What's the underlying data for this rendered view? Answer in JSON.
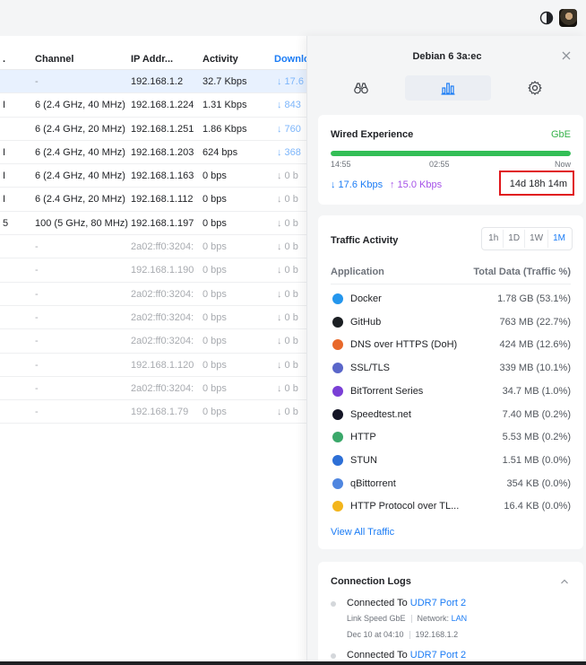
{
  "table": {
    "headers": {
      "edge": ".",
      "channel": "Channel",
      "ip": "IP Addr...",
      "activity": "Activity",
      "download": "Downlc"
    },
    "rows": [
      {
        "edge": "",
        "channel": "-",
        "ip": "192.168.1.2",
        "activity": "32.7 Kbps",
        "dl": "↓  17.6",
        "style": "sel"
      },
      {
        "edge": "I",
        "channel": "6 (2.4 GHz, 40 MHz)",
        "ip": "192.168.1.224",
        "activity": "1.31 Kbps",
        "dl": "↓  843",
        "style": ""
      },
      {
        "edge": "",
        "channel": "6 (2.4 GHz, 20 MHz)",
        "ip": "192.168.1.251",
        "activity": "1.86 Kbps",
        "dl": "↓  760",
        "style": ""
      },
      {
        "edge": "I",
        "channel": "6 (2.4 GHz, 40 MHz)",
        "ip": "192.168.1.203",
        "activity": "624 bps",
        "dl": "↓  368",
        "style": ""
      },
      {
        "edge": "I",
        "channel": "6 (2.4 GHz, 40 MHz)",
        "ip": "192.168.1.163",
        "activity": "0 bps",
        "dl": "↓  0 b",
        "style": "plain"
      },
      {
        "edge": "I",
        "channel": "6 (2.4 GHz, 20 MHz)",
        "ip": "192.168.1.112",
        "activity": "0 bps",
        "dl": "↓  0 b",
        "style": "plain"
      },
      {
        "edge": "5",
        "channel": "100 (5 GHz, 80 MHz)",
        "ip": "192.168.1.197",
        "activity": "0 bps",
        "dl": "↓  0 b",
        "style": "plain"
      },
      {
        "edge": "",
        "channel": "-",
        "ip": "2a02:ff0:3204:",
        "activity": "0 bps",
        "dl": "↓  0 b",
        "style": "dim"
      },
      {
        "edge": "",
        "channel": "-",
        "ip": "192.168.1.190",
        "activity": "0 bps",
        "dl": "↓  0 b",
        "style": "dim"
      },
      {
        "edge": "",
        "channel": "-",
        "ip": "2a02:ff0:3204:",
        "activity": "0 bps",
        "dl": "↓  0 b",
        "style": "dim"
      },
      {
        "edge": "",
        "channel": "-",
        "ip": "2a02:ff0:3204:",
        "activity": "0 bps",
        "dl": "↓  0 b",
        "style": "dim"
      },
      {
        "edge": "",
        "channel": "-",
        "ip": "2a02:ff0:3204:",
        "activity": "0 bps",
        "dl": "↓  0 b",
        "style": "dim"
      },
      {
        "edge": "",
        "channel": "-",
        "ip": "192.168.1.120",
        "activity": "0 bps",
        "dl": "↓  0 b",
        "style": "dim"
      },
      {
        "edge": "",
        "channel": "-",
        "ip": "2a02:ff0:3204:",
        "activity": "0 bps",
        "dl": "↓  0 b",
        "style": "dim"
      },
      {
        "edge": "",
        "channel": "-",
        "ip": "192.168.1.79",
        "activity": "0 bps",
        "dl": "↓  0 b",
        "style": "dim"
      }
    ]
  },
  "panel": {
    "title": "Debian 6 3a:ec",
    "tabs": [
      {
        "name": "binoculars-icon",
        "active": false
      },
      {
        "name": "bar-chart-icon",
        "active": true
      },
      {
        "name": "gear-icon",
        "active": false
      }
    ],
    "wired": {
      "title": "Wired Experience",
      "speed": "GbE",
      "experience_fraction": 1.0,
      "ticks": [
        "14:55",
        "02:55",
        "Now"
      ],
      "down": "↓ 17.6 Kbps",
      "up": "↑ 15.0 Kbps",
      "uptime": "14d 18h 14m"
    },
    "traffic": {
      "title": "Traffic Activity",
      "ranges": [
        "1h",
        "1D",
        "1W",
        "1M"
      ],
      "col_app": "Application",
      "col_total": "Total Data (Traffic %)",
      "apps": [
        {
          "name": "Docker",
          "value": "1.78 GB (53.1%)",
          "color": "#2496ed"
        },
        {
          "name": "GitHub",
          "value": "763 MB (22.7%)",
          "color": "#1b1f23"
        },
        {
          "name": "DNS over HTTPS (DoH)",
          "value": "424 MB (12.6%)",
          "color": "#e8682a"
        },
        {
          "name": "SSL/TLS",
          "value": "339 MB (10.1%)",
          "color": "#5a66c9"
        },
        {
          "name": "BitTorrent Series",
          "value": "34.7 MB (1.0%)",
          "color": "#7a3fd6"
        },
        {
          "name": "Speedtest.net",
          "value": "7.40 MB (0.2%)",
          "color": "#141526"
        },
        {
          "name": "HTTP",
          "value": "5.53 MB (0.2%)",
          "color": "#3aa86a"
        },
        {
          "name": "STUN",
          "value": "1.51 MB (0.0%)",
          "color": "#2d6fd6"
        },
        {
          "name": "qBittorrent",
          "value": "354 KB (0.0%)",
          "color": "#4f86e0"
        },
        {
          "name": "HTTP Protocol over TL...",
          "value": "16.4 KB (0.0%)",
          "color": "#f3b51b"
        }
      ],
      "view_all": "View All Traffic"
    },
    "logs": {
      "title": "Connection Logs",
      "entries": [
        {
          "prefix": "Connected To ",
          "link": "UDR7 Port 2",
          "meta1_label": "Link Speed GbE",
          "meta1_net_label": "Network: ",
          "meta1_net": "LAN",
          "meta2_time": "Dec 10 at 04:10",
          "meta2_ip": "192.168.1.2"
        },
        {
          "prefix": "Connected To ",
          "link": "UDR7 Port 2"
        }
      ]
    }
  }
}
